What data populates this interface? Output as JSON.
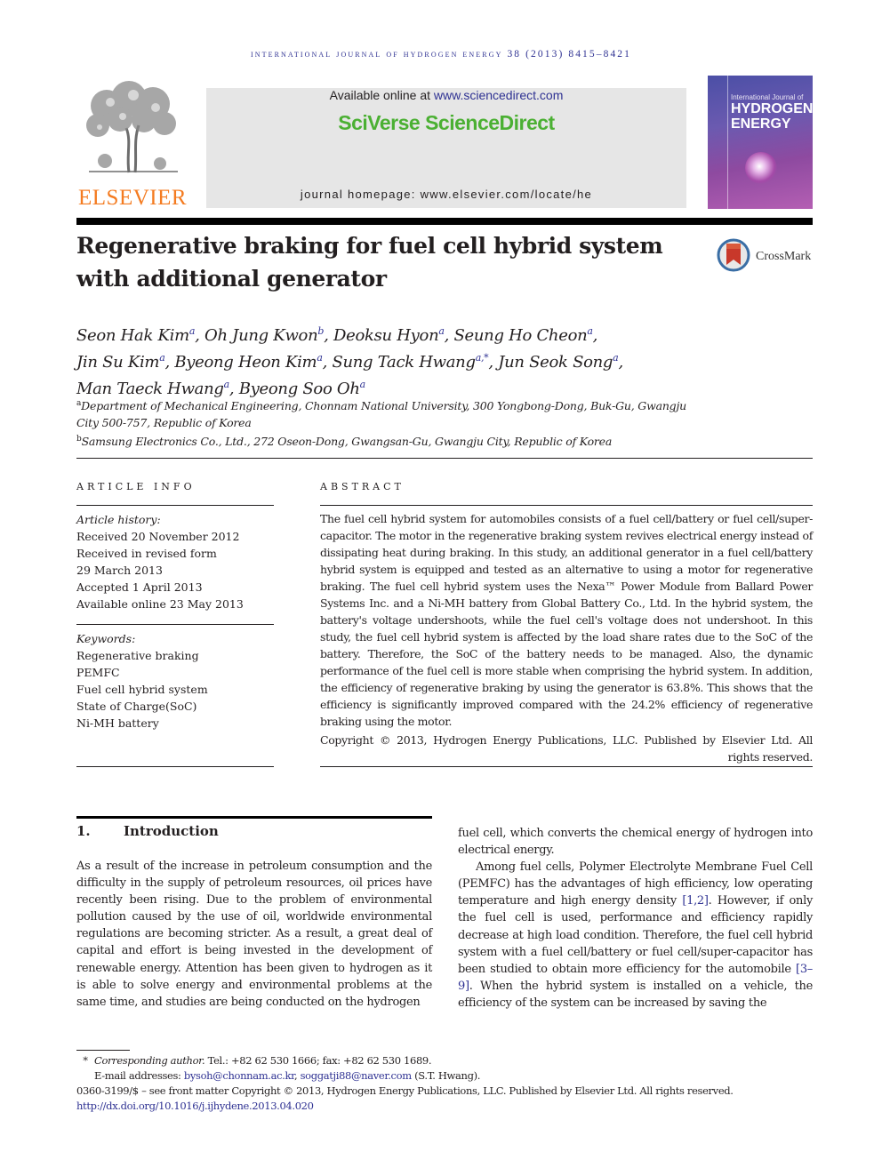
{
  "running_header": "International Journal of Hydrogen Energy 38 (2013) 8415–8421",
  "masthead": {
    "publisher_logo_text": "ELSEVIER",
    "available_prefix": "Available online at ",
    "available_link": "www.sciencedirect.com",
    "brand": "SciVerse ScienceDirect",
    "homepage": "journal homepage: www.elsevier.com/locate/he",
    "cover": {
      "line1": "International Journal of",
      "line2": "HYDROGEN",
      "line3": "ENERGY"
    },
    "colors": {
      "brand_green": "#4bb033",
      "elsevier_orange": "#f47b20",
      "link_blue": "#2e3192"
    }
  },
  "article": {
    "title": "Regenerative braking for fuel cell hybrid system with additional generator",
    "crossmark_label": "CrossMark",
    "authors": [
      {
        "name": "Seon Hak Kim",
        "aff": "a"
      },
      {
        "name": "Oh Jung Kwon",
        "aff": "b"
      },
      {
        "name": "Deoksu Hyon",
        "aff": "a"
      },
      {
        "name": "Seung Ho Cheon",
        "aff": "a"
      },
      {
        "name": "Jin Su Kim",
        "aff": "a"
      },
      {
        "name": "Byeong Heon Kim",
        "aff": "a"
      },
      {
        "name": "Sung Tack Hwang",
        "aff": "a,*"
      },
      {
        "name": "Jun Seok Song",
        "aff": "a"
      },
      {
        "name": "Man Taeck Hwang",
        "aff": "a"
      },
      {
        "name": "Byeong Soo Oh",
        "aff": "a"
      }
    ],
    "affiliations": [
      {
        "mark": "a",
        "text": "Department of Mechanical Engineering, Chonnam National University, 300 Yongbong-Dong, Buk-Gu, Gwangju City 500-757, Republic of Korea"
      },
      {
        "mark": "b",
        "text": "Samsung Electronics Co., Ltd., 272 Oseon-Dong, Gwangsan-Gu, Gwangju City, Republic of Korea"
      }
    ]
  },
  "article_info": {
    "heading": "ARTICLE INFO",
    "history_label": "Article history:",
    "history": [
      "Received 20 November 2012",
      "Received in revised form",
      "29 March 2013",
      "Accepted 1 April 2013",
      "Available online 23 May 2013"
    ],
    "keywords_label": "Keywords:",
    "keywords": [
      "Regenerative braking",
      "PEMFC",
      "Fuel cell hybrid system",
      "State of Charge(SoC)",
      "Ni-MH battery"
    ]
  },
  "abstract": {
    "heading": "ABSTRACT",
    "body": "The fuel cell hybrid system for automobiles consists of a fuel cell/battery or fuel cell/super-capacitor. The motor in the regenerative braking system revives electrical energy instead of dissipating heat during braking. In this study, an additional generator in a fuel cell/battery hybrid system is equipped and tested as an alternative to using a motor for regenerative braking. The fuel cell hybrid system uses the Nexa™ Power Module from Ballard Power Systems Inc. and a Ni-MH battery from Global Battery Co., Ltd. In the hybrid system, the battery's voltage undershoots, while the fuel cell's voltage does not undershoot. In this study, the fuel cell hybrid system is affected by the load share rates due to the SoC of the battery. Therefore, the SoC of the battery needs to be managed. Also, the dynamic performance of the fuel cell is more stable when comprising the hybrid system. In addition, the efficiency of regenerative braking by using the generator is 63.8%. This shows that the efficiency is significantly improved compared with the 24.2% efficiency of regenerative braking using the motor.",
    "copyright": "Copyright © 2013, Hydrogen Energy Publications, LLC. Published by Elsevier Ltd. All rights reserved."
  },
  "introduction": {
    "number": "1.",
    "title": "Introduction",
    "left_para": "As a result of the increase in petroleum consumption and the difficulty in the supply of petroleum resources, oil prices have recently been rising. Due to the problem of environmental pollution caused by the use of oil, worldwide environmental regulations are becoming stricter. As a result, a great deal of capital and effort is being invested in the development of renewable energy. Attention has been given to hydrogen as it is able to solve energy and environmental problems at the same time, and studies are being conducted on the hydrogen",
    "right_para1": "fuel cell, which converts the chemical energy of hydrogen into electrical energy.",
    "right_para2_a": "Among fuel cells, Polymer Electrolyte Membrane Fuel Cell (PEMFC) has the advantages of high efficiency, low operating temperature and high energy density ",
    "right_para2_ref1": "[1,2]",
    "right_para2_b": ". However, if only the fuel cell is used, performance and efficiency rapidly decrease at high load condition. Therefore, the fuel cell hybrid system with a fuel cell/battery or fuel cell/super-capacitor has been studied to obtain more efficiency for the automobile ",
    "right_para2_ref2": "[3–9]",
    "right_para2_c": ". When the hybrid system is installed on a vehicle, the efficiency of the system can be increased by saving the"
  },
  "footnotes": {
    "star": "*",
    "corresponding_label": "Corresponding author.",
    "contact": " Tel.: +82 62 530 1666; fax: +82 62 530 1689.",
    "email_prefix": "E-mail addresses: ",
    "email1": "bysoh@chonnam.ac.kr",
    "email_sep": ", ",
    "email2": "soggatji88@naver.com",
    "email_suffix": " (S.T. Hwang).",
    "issn_line": "0360-3199/$ – see front matter Copyright © 2013, Hydrogen Energy Publications, LLC. Published by Elsevier Ltd. All rights reserved.",
    "doi": "http://dx.doi.org/10.1016/j.ijhydene.2013.04.020"
  }
}
